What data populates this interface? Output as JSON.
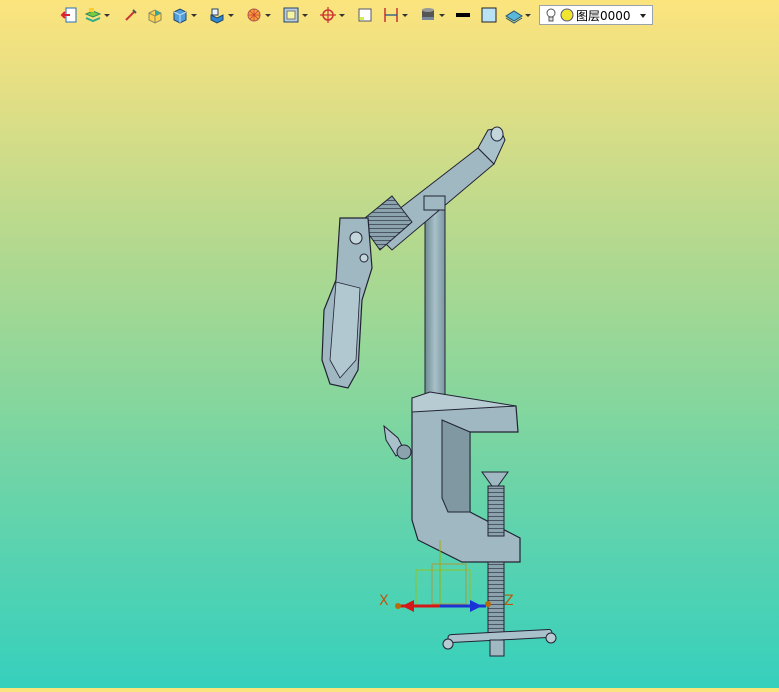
{
  "toolbar": {
    "layer_select": {
      "value": "图层0000"
    }
  },
  "axes": {
    "x_label": "X",
    "z_label": "Z"
  }
}
